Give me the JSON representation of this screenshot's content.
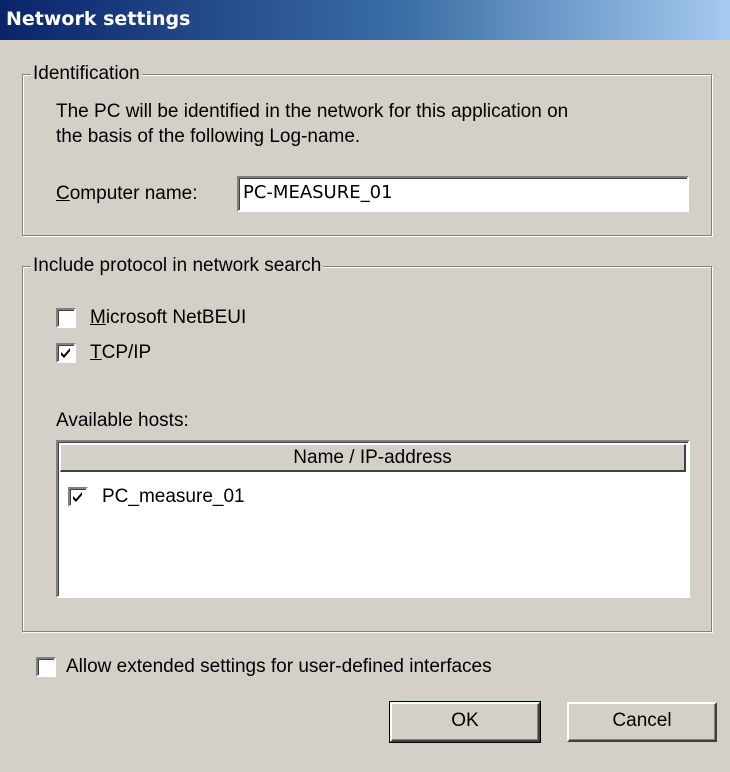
{
  "window": {
    "title": "Network settings"
  },
  "identification": {
    "legend": "Identification",
    "description_line1": "The PC will be identified in the network for this application on",
    "description_line2": "the basis of the following Log-name.",
    "computer_name_label_mnemonic": "C",
    "computer_name_label_rest": "omputer name:",
    "computer_name_value": "PC-MEASURE_01"
  },
  "protocols": {
    "legend": "Include protocol in network search",
    "netbeui": {
      "mnemonic": "M",
      "rest": "icrosoft NetBEUI",
      "checked": false
    },
    "tcpip": {
      "mnemonic": "T",
      "rest": "CP/IP",
      "checked": true
    },
    "available_hosts_label": "Available hosts:",
    "hosts_column_header": "Name / IP-address",
    "hosts": [
      {
        "name": "PC_measure_01",
        "checked": true
      }
    ]
  },
  "extended_settings": {
    "label": "Allow extended settings for user-defined interfaces",
    "checked": false
  },
  "buttons": {
    "ok": "OK",
    "cancel": "Cancel"
  }
}
